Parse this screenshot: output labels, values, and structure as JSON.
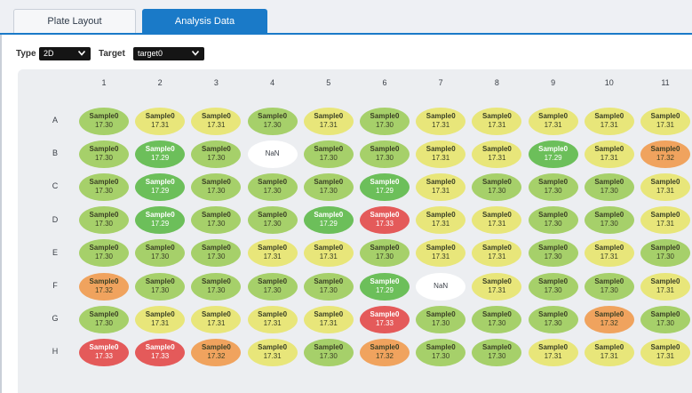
{
  "tabs": [
    {
      "label": "Plate Layout",
      "active": false
    },
    {
      "label": "Analysis Data",
      "active": true
    }
  ],
  "filters": {
    "type_label": "Type",
    "type_value": "2D",
    "target_label": "Target",
    "target_value": "target0"
  },
  "columns": [
    "1",
    "2",
    "3",
    "4",
    "5",
    "6",
    "7",
    "8",
    "9",
    "10",
    "11"
  ],
  "rows": [
    "A",
    "B",
    "C",
    "D",
    "E",
    "F",
    "G",
    "H"
  ],
  "color_scale": {
    "17.29": "#6cbf5a",
    "17.30": "#a6d06a",
    "17.31": "#e8e67a",
    "17.32": "#f0a35e",
    "17.33": "#e45a5a",
    "NaN": "#ffffff"
  },
  "wells": [
    [
      {
        "name": "Sample0",
        "value": "17.30"
      },
      {
        "name": "Sample0",
        "value": "17.31"
      },
      {
        "name": "Sample0",
        "value": "17.31"
      },
      {
        "name": "Sample0",
        "value": "17.30"
      },
      {
        "name": "Sample0",
        "value": "17.31"
      },
      {
        "name": "Sample0",
        "value": "17.30"
      },
      {
        "name": "Sample0",
        "value": "17.31"
      },
      {
        "name": "Sample0",
        "value": "17.31"
      },
      {
        "name": "Sample0",
        "value": "17.31"
      },
      {
        "name": "Sample0",
        "value": "17.31"
      },
      {
        "name": "Sample0",
        "value": "17.31"
      }
    ],
    [
      {
        "name": "Sample0",
        "value": "17.30"
      },
      {
        "name": "Sample0",
        "value": "17.29"
      },
      {
        "name": "Sample0",
        "value": "17.30"
      },
      {
        "name": "",
        "value": "NaN"
      },
      {
        "name": "Sample0",
        "value": "17.30"
      },
      {
        "name": "Sample0",
        "value": "17.30"
      },
      {
        "name": "Sample0",
        "value": "17.31"
      },
      {
        "name": "Sample0",
        "value": "17.31"
      },
      {
        "name": "Sample0",
        "value": "17.29"
      },
      {
        "name": "Sample0",
        "value": "17.31"
      },
      {
        "name": "Sample0",
        "value": "17.32"
      }
    ],
    [
      {
        "name": "Sample0",
        "value": "17.30"
      },
      {
        "name": "Sample0",
        "value": "17.29"
      },
      {
        "name": "Sample0",
        "value": "17.30"
      },
      {
        "name": "Sample0",
        "value": "17.30"
      },
      {
        "name": "Sample0",
        "value": "17.30"
      },
      {
        "name": "Sample0",
        "value": "17.29"
      },
      {
        "name": "Sample0",
        "value": "17.31"
      },
      {
        "name": "Sample0",
        "value": "17.30"
      },
      {
        "name": "Sample0",
        "value": "17.30"
      },
      {
        "name": "Sample0",
        "value": "17.30"
      },
      {
        "name": "Sample0",
        "value": "17.31"
      }
    ],
    [
      {
        "name": "Sample0",
        "value": "17.30"
      },
      {
        "name": "Sample0",
        "value": "17.29"
      },
      {
        "name": "Sample0",
        "value": "17.30"
      },
      {
        "name": "Sample0",
        "value": "17.30"
      },
      {
        "name": "Sample0",
        "value": "17.29"
      },
      {
        "name": "Sample0",
        "value": "17.33"
      },
      {
        "name": "Sample0",
        "value": "17.31"
      },
      {
        "name": "Sample0",
        "value": "17.31"
      },
      {
        "name": "Sample0",
        "value": "17.30"
      },
      {
        "name": "Sample0",
        "value": "17.30"
      },
      {
        "name": "Sample0",
        "value": "17.31"
      }
    ],
    [
      {
        "name": "Sample0",
        "value": "17.30"
      },
      {
        "name": "Sample0",
        "value": "17.30"
      },
      {
        "name": "Sample0",
        "value": "17.30"
      },
      {
        "name": "Sample0",
        "value": "17.31"
      },
      {
        "name": "Sample0",
        "value": "17.31"
      },
      {
        "name": "Sample0",
        "value": "17.30"
      },
      {
        "name": "Sample0",
        "value": "17.31"
      },
      {
        "name": "Sample0",
        "value": "17.31"
      },
      {
        "name": "Sample0",
        "value": "17.30"
      },
      {
        "name": "Sample0",
        "value": "17.31"
      },
      {
        "name": "Sample0",
        "value": "17.30"
      }
    ],
    [
      {
        "name": "Sample0",
        "value": "17.32"
      },
      {
        "name": "Sample0",
        "value": "17.30"
      },
      {
        "name": "Sample0",
        "value": "17.30"
      },
      {
        "name": "Sample0",
        "value": "17.30"
      },
      {
        "name": "Sample0",
        "value": "17.30"
      },
      {
        "name": "Sample0",
        "value": "17.29"
      },
      {
        "name": "",
        "value": "NaN"
      },
      {
        "name": "Sample0",
        "value": "17.31"
      },
      {
        "name": "Sample0",
        "value": "17.30"
      },
      {
        "name": "Sample0",
        "value": "17.30"
      },
      {
        "name": "Sample0",
        "value": "17.31"
      }
    ],
    [
      {
        "name": "Sample0",
        "value": "17.30"
      },
      {
        "name": "Sample0",
        "value": "17.31"
      },
      {
        "name": "Sample0",
        "value": "17.31"
      },
      {
        "name": "Sample0",
        "value": "17.31"
      },
      {
        "name": "Sample0",
        "value": "17.31"
      },
      {
        "name": "Sample0",
        "value": "17.33"
      },
      {
        "name": "Sample0",
        "value": "17.30"
      },
      {
        "name": "Sample0",
        "value": "17.30"
      },
      {
        "name": "Sample0",
        "value": "17.30"
      },
      {
        "name": "Sample0",
        "value": "17.32"
      },
      {
        "name": "Sample0",
        "value": "17.30"
      }
    ],
    [
      {
        "name": "Sample0",
        "value": "17.33"
      },
      {
        "name": "Sample0",
        "value": "17.33"
      },
      {
        "name": "Sample0",
        "value": "17.32"
      },
      {
        "name": "Sample0",
        "value": "17.31"
      },
      {
        "name": "Sample0",
        "value": "17.30"
      },
      {
        "name": "Sample0",
        "value": "17.32"
      },
      {
        "name": "Sample0",
        "value": "17.30"
      },
      {
        "name": "Sample0",
        "value": "17.30"
      },
      {
        "name": "Sample0",
        "value": "17.31"
      },
      {
        "name": "Sample0",
        "value": "17.31"
      },
      {
        "name": "Sample0",
        "value": "17.31"
      }
    ]
  ]
}
